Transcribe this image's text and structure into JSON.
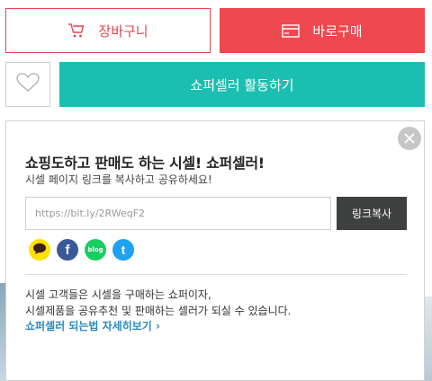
{
  "actions": {
    "cart_label": "장바구니",
    "buy_label": "바로구매",
    "seller_label": "쇼퍼셀러 활동하기"
  },
  "popup": {
    "title": "쇼핑도하고 판매도 하는 시셀! 쇼퍼셀러!",
    "subtitle": "시셀 페이지 링크를 복사하고 공유하세요!",
    "url_value": "https://bit.ly/2RWeqF2",
    "copy_label": "링크복사",
    "sns": [
      {
        "icon": "kakaotalk-icon"
      },
      {
        "icon": "facebook-icon",
        "glyph": "f"
      },
      {
        "icon": "blog-icon",
        "glyph": "blog"
      },
      {
        "icon": "twitter-icon",
        "glyph": "t"
      }
    ],
    "desc_line1": "시셀 고객들은 시셀을 구매하는 쇼퍼이자,",
    "desc_line2": "시셀제품을 공유추천 및 판매하는 셀러가 되실 수 있습니다.",
    "more_link": "쇼퍼셀러 되는법 자세히보기 ›"
  },
  "colors": {
    "cart_accent": "#e8454e",
    "buy_bg": "#f0484f",
    "seller_bg": "#1bbfb1",
    "copy_bg": "#3f4040",
    "link": "#2a8bbf"
  }
}
